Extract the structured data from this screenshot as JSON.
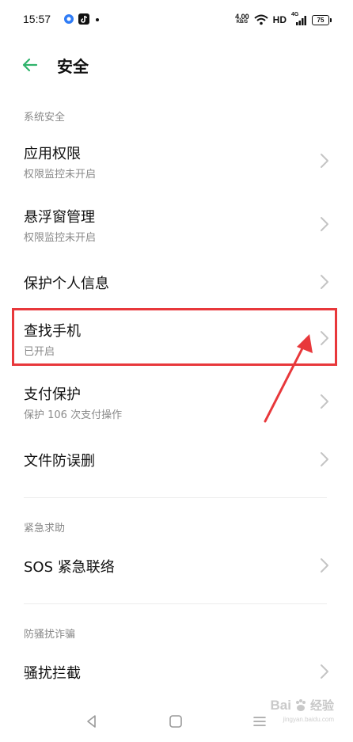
{
  "status_bar": {
    "time": "15:57",
    "net_speed_value": "4.00",
    "net_speed_unit": "KB/S",
    "network_type": "HD",
    "signal_label": "4G",
    "battery": "75"
  },
  "header": {
    "title": "安全"
  },
  "sections": [
    {
      "label": "系统安全",
      "items": [
        {
          "title": "应用权限",
          "subtitle": "权限监控未开启"
        },
        {
          "title": "悬浮窗管理",
          "subtitle": "权限监控未开启"
        },
        {
          "title": "保护个人信息",
          "subtitle": ""
        },
        {
          "title": "查找手机",
          "subtitle": "已开启"
        },
        {
          "title": "支付保护",
          "subtitle": "保护 106 次支付操作"
        },
        {
          "title": "文件防误删",
          "subtitle": ""
        }
      ]
    },
    {
      "label": "紧急求助",
      "items": [
        {
          "title": "SOS 紧急联络",
          "subtitle": ""
        }
      ]
    },
    {
      "label": "防骚扰诈骗",
      "items": [
        {
          "title": "骚扰拦截",
          "subtitle": ""
        }
      ]
    }
  ],
  "annotation": {
    "highlight_color": "#e8383b"
  },
  "watermark": {
    "brand_en": "Bai",
    "brand_cn": "经验",
    "url": "jingyan.baidu.com"
  },
  "colors": {
    "accent_back_arrow": "#2fb36b",
    "tiktok_icon_bg": "#111111",
    "app_icon_blue": "#2f7cf6"
  }
}
